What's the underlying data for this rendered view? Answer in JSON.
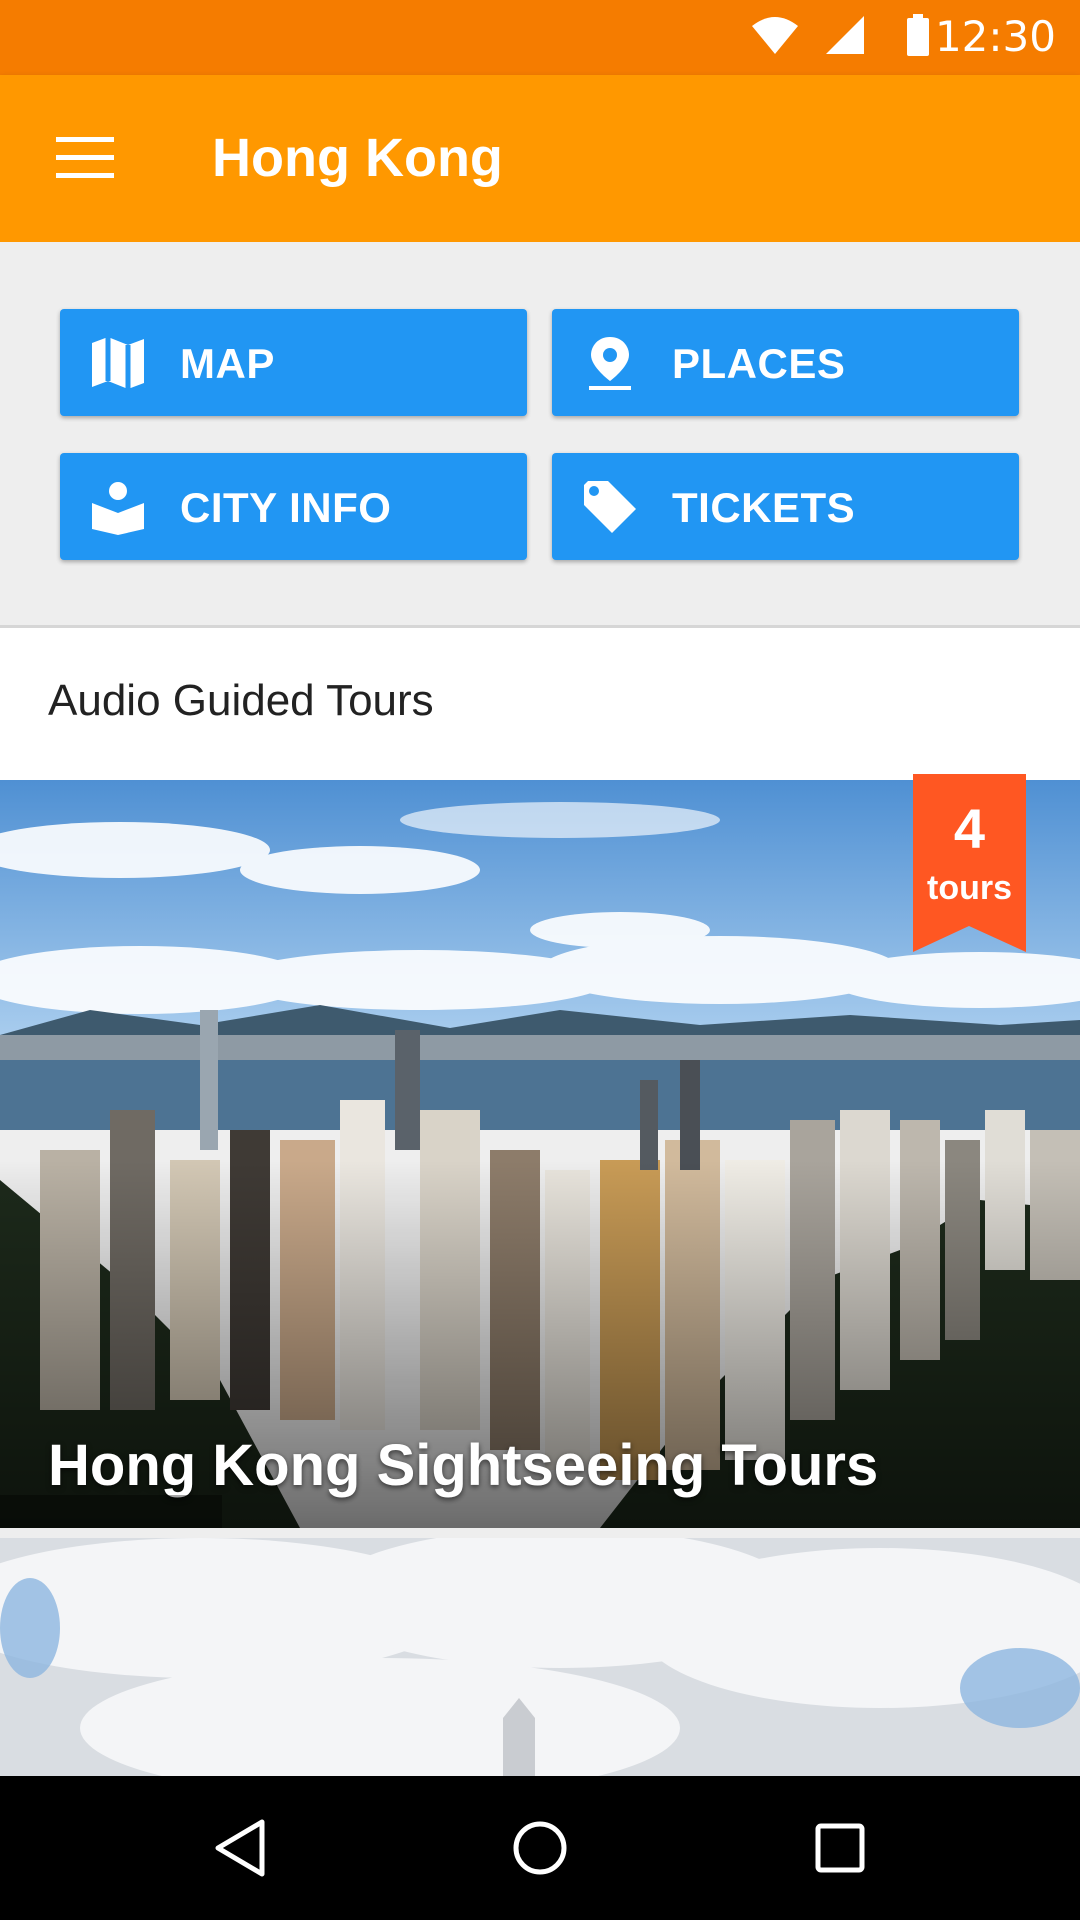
{
  "status_bar": {
    "time": "12:30",
    "icons": [
      "wifi-icon",
      "cell-signal-icon",
      "battery-icon"
    ]
  },
  "app_bar": {
    "title": "Hong Kong",
    "menu_icon": "menu-icon"
  },
  "quick_buttons": [
    {
      "label": "MAP",
      "icon": "map-icon"
    },
    {
      "label": "PLACES",
      "icon": "place-pin-icon"
    },
    {
      "label": "CITY INFO",
      "icon": "guide-book-icon"
    },
    {
      "label": "TICKETS",
      "icon": "ticket-tag-icon"
    }
  ],
  "section": {
    "title": "Audio Guided Tours"
  },
  "tours": [
    {
      "title": "Hong Kong Sightseeing Tours",
      "badge_count": "4",
      "badge_label": "tours"
    }
  ],
  "navigation": {
    "buttons": [
      "back-icon",
      "home-icon",
      "recents-icon"
    ]
  },
  "colors": {
    "status_bar": "#f57c00",
    "app_bar": "#ff9800",
    "button": "#2196f3",
    "badge": "#ff5722"
  }
}
